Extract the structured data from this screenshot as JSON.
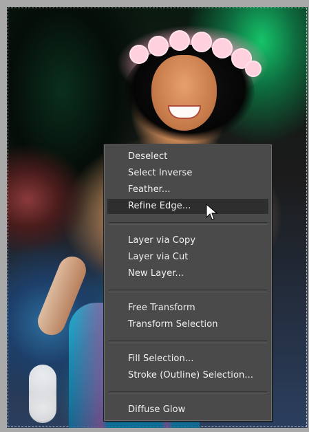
{
  "context_menu": {
    "items": [
      {
        "label": "Deselect"
      },
      {
        "label": "Select Inverse"
      },
      {
        "label": "Feather..."
      },
      {
        "label": "Refine Edge..."
      },
      {
        "label": "Layer via Copy"
      },
      {
        "label": "Layer via Cut"
      },
      {
        "label": "New Layer..."
      },
      {
        "label": "Free Transform"
      },
      {
        "label": "Transform Selection"
      },
      {
        "label": "Fill Selection..."
      },
      {
        "label": "Stroke (Outline) Selection..."
      },
      {
        "label": "Diffuse Glow"
      }
    ],
    "highlighted_item": "Refine Edge..."
  },
  "colors": {
    "menu_background": "#4a4a4a",
    "menu_text": "#f2f2f2",
    "menu_highlight": "#2e2e2e"
  },
  "icons": {
    "cursor": "mouse-pointer-icon"
  }
}
